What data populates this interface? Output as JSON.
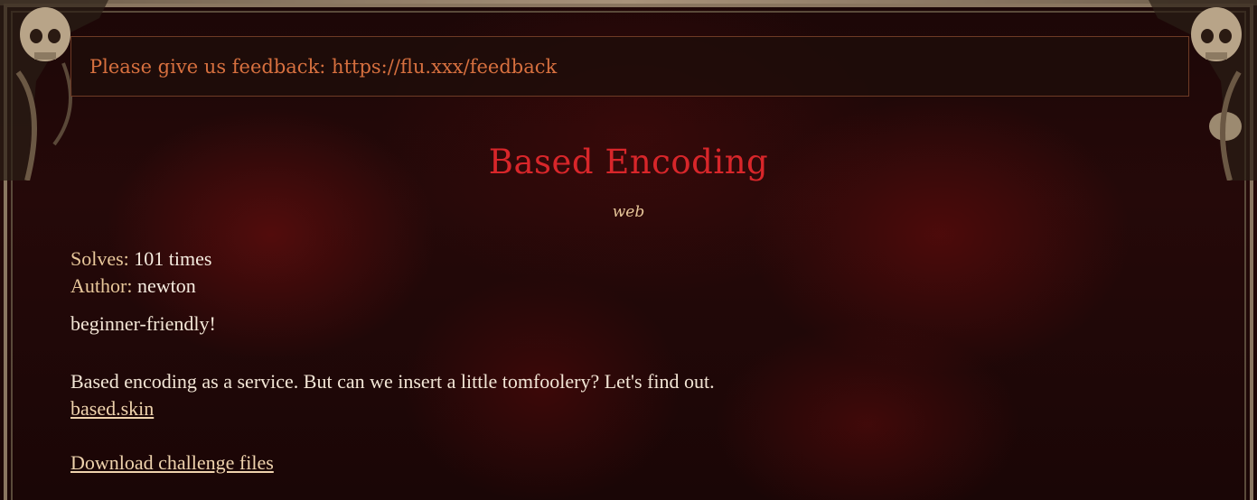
{
  "banner": {
    "text": "Please give us feedback: https://flu.xxx/feedback"
  },
  "challenge": {
    "title": "Based Encoding",
    "category": "web",
    "solves_label": "Solves:",
    "solves_value": "101 times",
    "author_label": "Author:",
    "author_value": "newton",
    "tag": "beginner-friendly!",
    "description": "Based encoding as a service. But can we insert a little tomfoolery? Let's find out.",
    "link_text": "based.skin",
    "download_text": "Download challenge files"
  },
  "colors": {
    "title": "#d8262a",
    "banner_text": "#d7703f",
    "label": "#e8c79a",
    "link": "#efd3ad"
  },
  "icons": {
    "corner_left": "skull-ornament-icon",
    "corner_right": "skull-ornament-icon"
  }
}
